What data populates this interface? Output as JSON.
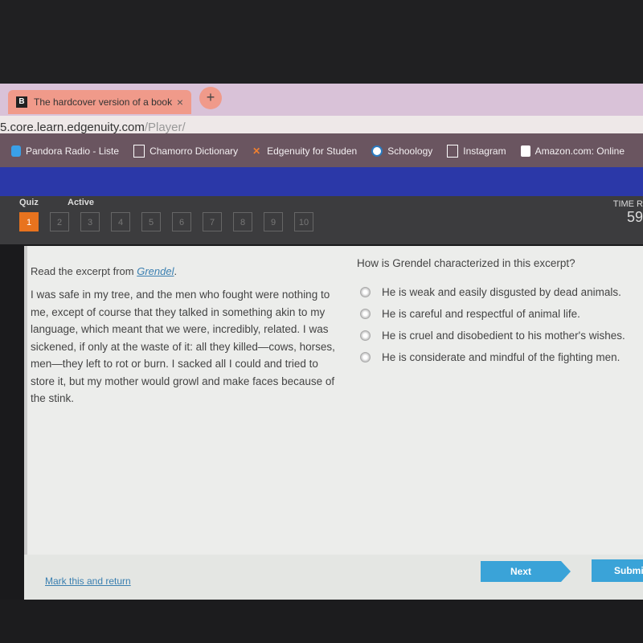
{
  "browser": {
    "tab_title": "The hardcover version of a book",
    "tab_favicon": "B",
    "close_icon": "×",
    "new_tab": "+",
    "url_host": "5.core.learn.edgenuity.com",
    "url_path": "/Player/"
  },
  "bookmarks": [
    {
      "label": "Pandora Radio - Liste",
      "icon": "pandora-icon"
    },
    {
      "label": "Chamorro Dictionary",
      "icon": "page-icon"
    },
    {
      "label": "Edgenuity for Studen",
      "icon": "edgenuity-icon"
    },
    {
      "label": "Schoology",
      "icon": "schoology-icon"
    },
    {
      "label": "Instagram",
      "icon": "page-icon"
    },
    {
      "label": "Amazon.com: Online",
      "icon": "amazon-icon"
    }
  ],
  "quiz": {
    "label": "Quiz",
    "status": "Active",
    "questions": [
      "1",
      "2",
      "3",
      "4",
      "5",
      "6",
      "7",
      "8",
      "9",
      "10"
    ],
    "current": "1",
    "time_label": "TIME R",
    "time_value": "59"
  },
  "passage": {
    "prompt_prefix": "Read the excerpt from ",
    "book_title": "Grendel",
    "prompt_suffix": ".",
    "text": "I was safe in my tree, and the men who fought were nothing to me, except of course that they talked in something akin to my language, which meant that we were, incredibly, related. I was sickened, if only at the waste of it: all they killed—cows, horses, men—they left to rot or burn. I sacked all I could and tried to store it, but my mother would growl and make faces because of the stink."
  },
  "question": {
    "text": "How is Grendel characterized in this excerpt?",
    "options": [
      "He is weak and easily disgusted by dead animals.",
      "He is careful and respectful of animal life.",
      "He is cruel and disobedient to his mother's wishes.",
      "He is considerate and mindful of the fighting men."
    ]
  },
  "footer": {
    "mark_return": "Mark this and return",
    "next": "Next",
    "submit": "Submit"
  },
  "colors": {
    "accent": "#3aa3d8",
    "current_question": "#e8731e",
    "header_blue": "#2b38a8"
  }
}
